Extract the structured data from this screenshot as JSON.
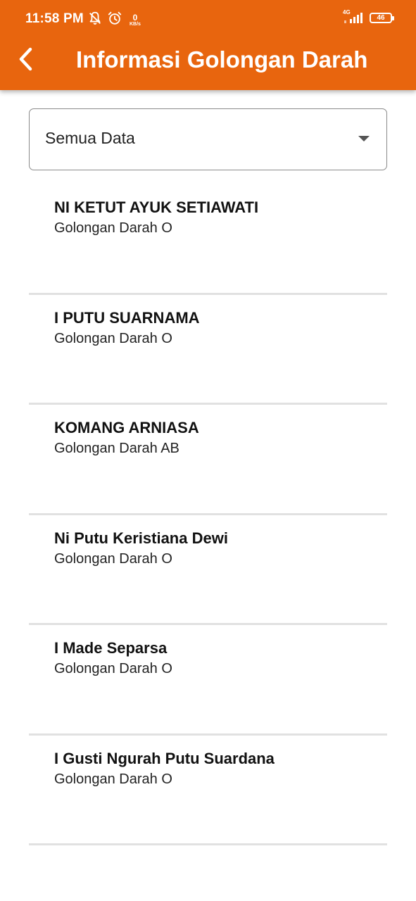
{
  "status_bar": {
    "time": "11:58 PM",
    "speed_value": "0",
    "speed_unit": "KB/s",
    "network": "4G",
    "battery": "46",
    "icons": [
      "notifications-off-icon",
      "alarm-icon",
      "signal-icon",
      "battery-icon"
    ]
  },
  "app_bar": {
    "back_icon": "back-arrow-icon",
    "title": "Informasi Golongan Darah",
    "color": "#e8650e"
  },
  "filter": {
    "selected": "Semua Data",
    "icon": "dropdown-arrow-icon"
  },
  "items": [
    {
      "name": "NI KETUT AYUK SETIAWATI",
      "blood": "Golongan Darah O"
    },
    {
      "name": "I PUTU SUARNAMA",
      "blood": "Golongan Darah O"
    },
    {
      "name": "KOMANG ARNIASA",
      "blood": "Golongan Darah AB"
    },
    {
      "name": "Ni Putu Keristiana Dewi",
      "blood": "Golongan Darah O"
    },
    {
      "name": "I Made Separsa",
      "blood": "Golongan Darah O"
    },
    {
      "name": "I Gusti Ngurah Putu Suardana",
      "blood": "Golongan Darah O"
    }
  ]
}
